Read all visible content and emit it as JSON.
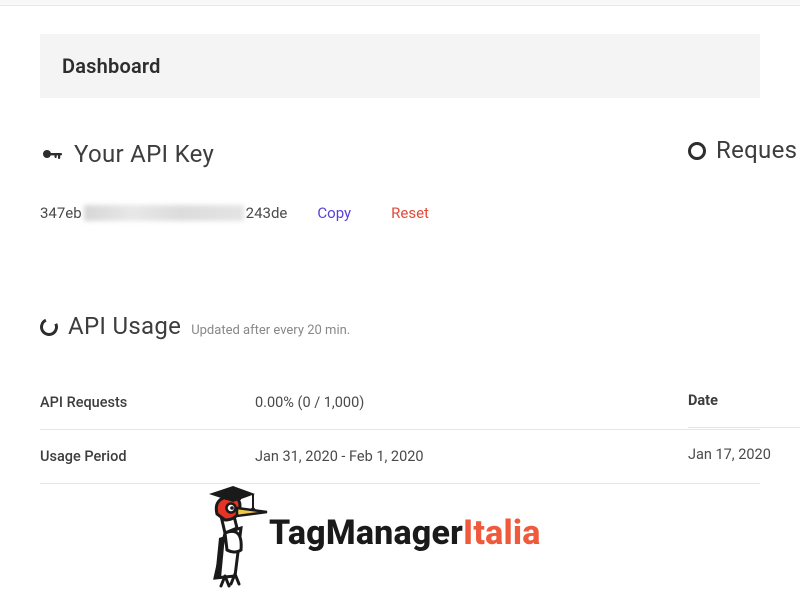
{
  "header": {
    "title": "Dashboard"
  },
  "api_key": {
    "section_label": "Your API Key",
    "prefix": "347eb",
    "suffix": "243de",
    "copy_label": "Copy",
    "reset_label": "Reset"
  },
  "requests": {
    "section_label": "Reques"
  },
  "usage": {
    "section_label": "API Usage",
    "update_note": "Updated after every 20 min.",
    "rows": {
      "requests_label": "API Requests",
      "requests_value": "0.00% (0 / 1,000)",
      "period_label": "Usage Period",
      "period_value": "Jan 31, 2020 - Feb 1, 2020"
    }
  },
  "right_table": {
    "date_label": "Date",
    "date_value": "Jan 17, 2020"
  },
  "branding": {
    "part1": "TagManager",
    "part2": "Italia"
  }
}
